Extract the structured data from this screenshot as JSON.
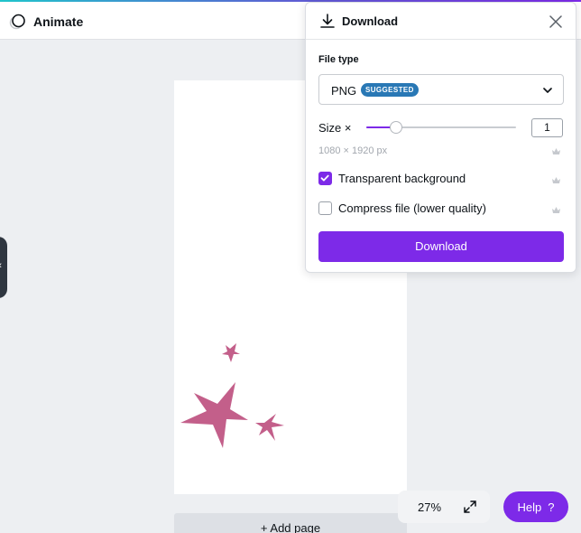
{
  "app": {
    "title": "Animate"
  },
  "panel": {
    "title": "Download",
    "file_type_label": "File type",
    "file_type_value": "PNG",
    "file_type_badge": "SUGGESTED",
    "size_label": "Size ×",
    "size_value": "1",
    "size_slider_fraction": 0.2,
    "dimensions": "1080 × 1920 px",
    "options": [
      {
        "label": "Transparent background",
        "checked": true,
        "premium": true
      },
      {
        "label": "Compress file (lower quality)",
        "checked": false,
        "premium": true
      }
    ],
    "download_button": "Download"
  },
  "canvas": {
    "add_page_label": "+ Add page",
    "star_color": "#c35f8a"
  },
  "footer": {
    "zoom": "27%",
    "help_label": "Help",
    "help_icon": "?"
  },
  "colors": {
    "accent": "#7d2ae8",
    "badge": "#2978b5",
    "premium": "#c6c9ce"
  },
  "icons": [
    "animate-icon",
    "download-icon",
    "close-icon",
    "chevron-down-icon",
    "crown-icon",
    "expand-icon",
    "collapse-chevron-icon"
  ]
}
